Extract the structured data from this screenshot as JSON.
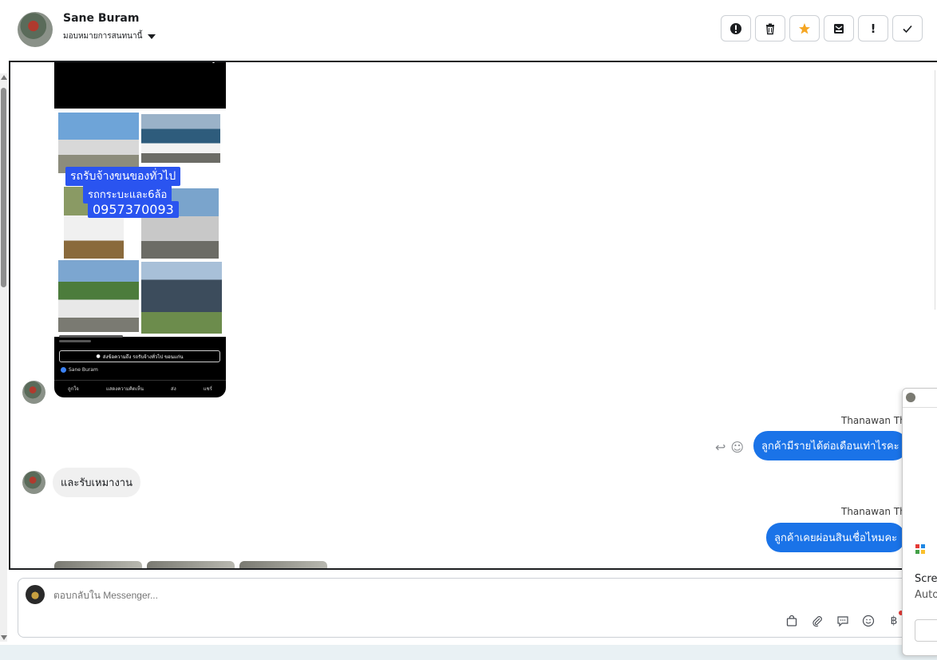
{
  "header": {
    "contact_name": "Sane Buram",
    "assign_label": "มอบหมายการสนทนานี้",
    "toolbar": [
      {
        "name": "report-icon",
        "glyph": "!"
      },
      {
        "name": "trash-icon",
        "glyph": "🗑"
      },
      {
        "name": "star-icon",
        "glyph": "★"
      },
      {
        "name": "archive-icon",
        "glyph": "✉"
      },
      {
        "name": "exclamation-icon",
        "glyph": "!"
      },
      {
        "name": "check-icon",
        "glyph": "✓"
      }
    ]
  },
  "post": {
    "overlay_line1": "รถรับจ้างขนของทั่วไป",
    "overlay_line2": "รถกระบะและ6ล้อ",
    "overlay_phone": "0957370093",
    "button_text": "ส่งข้อความถึง รถรับจ้างทั่วไป ขอนแก่น",
    "author": "Sane Buram",
    "actions": [
      "ถูกใจ",
      "แสดงความคิดเห็น",
      "ส่ง",
      "แชร์"
    ]
  },
  "messages": [
    {
      "type": "out",
      "sender": "Thanawan Tho",
      "text": "ลูกค้ามีรายได้ต่อเดือนเท่าไรคะ"
    },
    {
      "type": "in",
      "text": "และรับเหมางาน"
    },
    {
      "type": "out",
      "sender": "Thanawan Tho",
      "text": "ลูกค้าเคยผ่อนสินเชื่อไหมคะ"
    }
  ],
  "composer": {
    "placeholder": "ตอบกลับใน Messenger..."
  },
  "float_panel": {
    "screen_text": "Scre",
    "auto_text": "Auto",
    "letter": "S"
  },
  "colors": {
    "accent": "#1a73e8",
    "overlay_blue": "#2a54f0",
    "star": "#f5a623"
  }
}
